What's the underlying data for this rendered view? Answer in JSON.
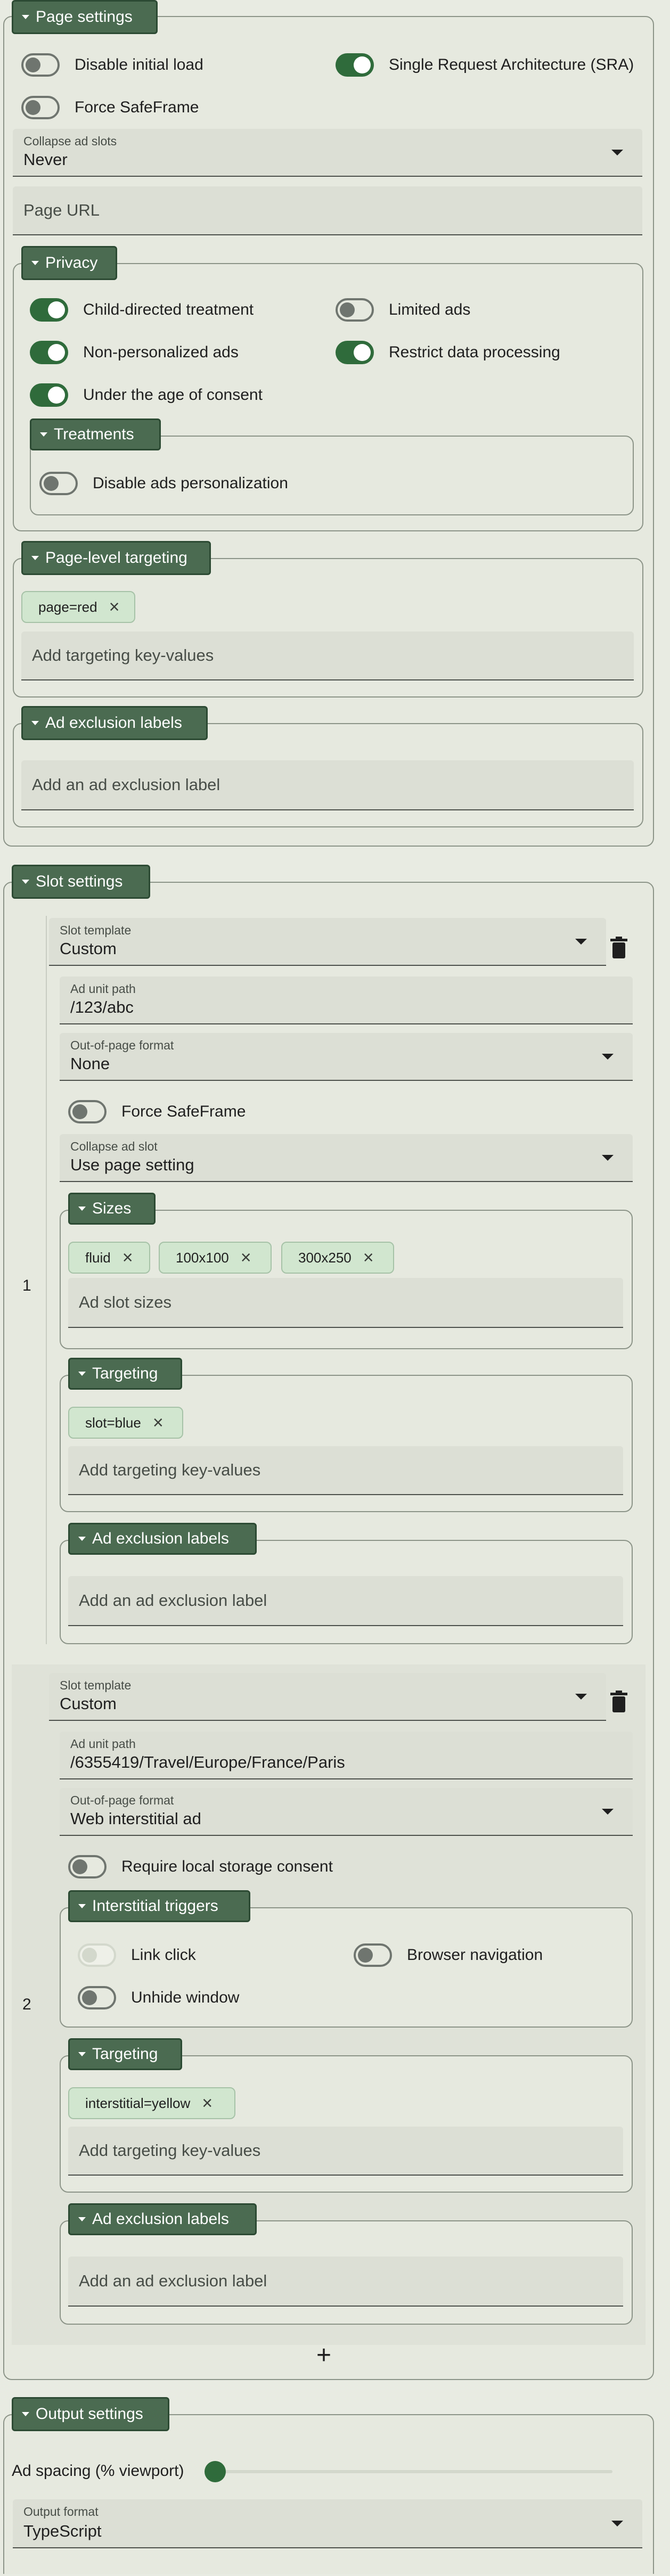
{
  "page_settings": {
    "title": "Page settings",
    "disable_initial_load": "Disable initial load",
    "sra": "Single Request Architecture (SRA)",
    "force_safeframe": "Force SafeFrame",
    "collapse_label": "Collapse ad slots",
    "collapse_value": "Never",
    "page_url_placeholder": "Page URL",
    "privacy": {
      "title": "Privacy",
      "child_directed": "Child-directed treatment",
      "limited_ads": "Limited ads",
      "non_personalized": "Non-personalized ads",
      "restrict_processing": "Restrict data processing",
      "under_age": "Under the age of consent",
      "treatments": {
        "title": "Treatments",
        "disable_personalization": "Disable ads personalization"
      }
    },
    "targeting": {
      "title": "Page-level targeting",
      "chip": "page=red",
      "placeholder": "Add targeting key-values"
    },
    "exclusion": {
      "title": "Ad exclusion labels",
      "placeholder": "Add an ad exclusion label"
    }
  },
  "slot_settings": {
    "title": "Slot settings",
    "add": "+",
    "slots": [
      {
        "number": "1",
        "template_label": "Slot template",
        "template_value": "Custom",
        "path_label": "Ad unit path",
        "path_value": "/123/abc",
        "oop_label": "Out-of-page format",
        "oop_value": "None",
        "force_safeframe": "Force SafeFrame",
        "collapse_label": "Collapse ad slot",
        "collapse_value": "Use page setting",
        "sizes_title": "Sizes",
        "sizes": [
          "fluid",
          "100x100",
          "300x250"
        ],
        "sizes_placeholder": "Ad slot sizes",
        "targeting_title": "Targeting",
        "targeting_chip": "slot=blue",
        "targeting_placeholder": "Add targeting key-values",
        "exclusion_title": "Ad exclusion labels",
        "exclusion_placeholder": "Add an ad exclusion label"
      },
      {
        "number": "2",
        "template_label": "Slot template",
        "template_value": "Custom",
        "path_label": "Ad unit path",
        "path_value": "/6355419/Travel/Europe/France/Paris",
        "oop_label": "Out-of-page format",
        "oop_value": "Web interstitial ad",
        "local_storage": "Require local storage consent",
        "triggers_title": "Interstitial triggers",
        "link_click": "Link click",
        "browser_nav": "Browser navigation",
        "unhide": "Unhide window",
        "targeting_title": "Targeting",
        "targeting_chip": "interstitial=yellow",
        "targeting_placeholder": "Add targeting key-values",
        "exclusion_title": "Ad exclusion labels",
        "exclusion_placeholder": "Add an ad exclusion label"
      }
    ]
  },
  "output_settings": {
    "title": "Output settings",
    "ad_spacing_label": "Ad spacing (% viewport)",
    "ad_spacing_value": 0,
    "format_label": "Output format",
    "format_value": "TypeScript"
  },
  "colors": {
    "accent": "#2f6b3b",
    "legend": "#4b6b51",
    "chip": "#d1e6cf",
    "background": "#e8ebe2"
  }
}
